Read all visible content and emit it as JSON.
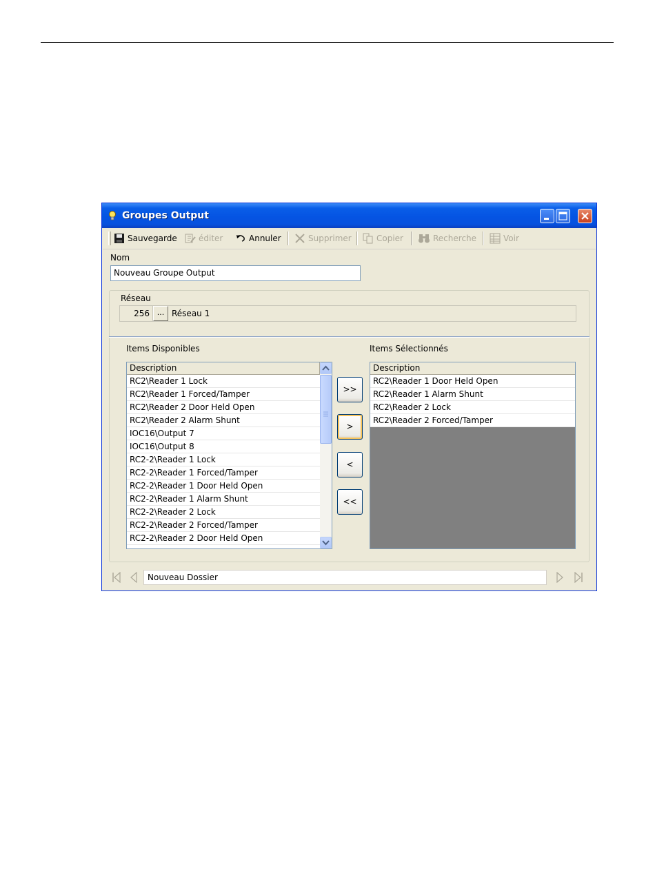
{
  "window": {
    "title": "Groupes Output",
    "colors": {
      "titlebar": "#0554e3",
      "close": "#c8401e",
      "listbox_border": "#7f9db9",
      "empty_area": "#808080"
    }
  },
  "toolbar": {
    "save": {
      "label": "Sauvegarde",
      "icon": "floppy-disk-icon"
    },
    "edit": {
      "label": "éditer",
      "icon": "edit-icon"
    },
    "cancel": {
      "label": "Annuler",
      "icon": "undo-icon"
    },
    "delete": {
      "label": "Supprimer",
      "icon": "x-icon"
    },
    "copy": {
      "label": "Copier",
      "icon": "copy-icon"
    },
    "search": {
      "label": "Recherche",
      "icon": "binoculars-icon"
    },
    "view": {
      "label": "Voir",
      "icon": "grid-icon"
    }
  },
  "form": {
    "nom_label": "Nom",
    "nom_value": "Nouveau Groupe Output",
    "reseau_label": "Réseau",
    "reseau_number": "256",
    "reseau_browse": "...",
    "reseau_name": "Réseau 1"
  },
  "available": {
    "label": "Items Disponibles",
    "header": "Description",
    "items": [
      "RC2\\Reader 1 Lock",
      "RC2\\Reader 1 Forced/Tamper",
      "RC2\\Reader 2 Door Held Open",
      "RC2\\Reader 2 Alarm Shunt",
      "IOC16\\Output 7",
      "IOC16\\Output 8",
      "RC2-2\\Reader 1 Lock",
      "RC2-2\\Reader 1 Forced/Tamper",
      "RC2-2\\Reader 1 Door Held Open",
      "RC2-2\\Reader 1 Alarm Shunt",
      "RC2-2\\Reader 2 Lock",
      "RC2-2\\Reader 2 Forced/Tamper",
      "RC2-2\\Reader 2 Door Held Open"
    ]
  },
  "selected": {
    "label": "Items Sélectionnés",
    "header": "Description",
    "items": [
      "RC2\\Reader 1 Door Held Open",
      "RC2\\Reader 1 Alarm Shunt",
      "RC2\\Reader 2 Lock",
      "RC2\\Reader 2 Forced/Tamper"
    ]
  },
  "move_buttons": {
    "add_all": ">>",
    "add": ">",
    "remove": "<",
    "remove_all": "<<"
  },
  "navigation": {
    "record": "Nouveau Dossier"
  }
}
